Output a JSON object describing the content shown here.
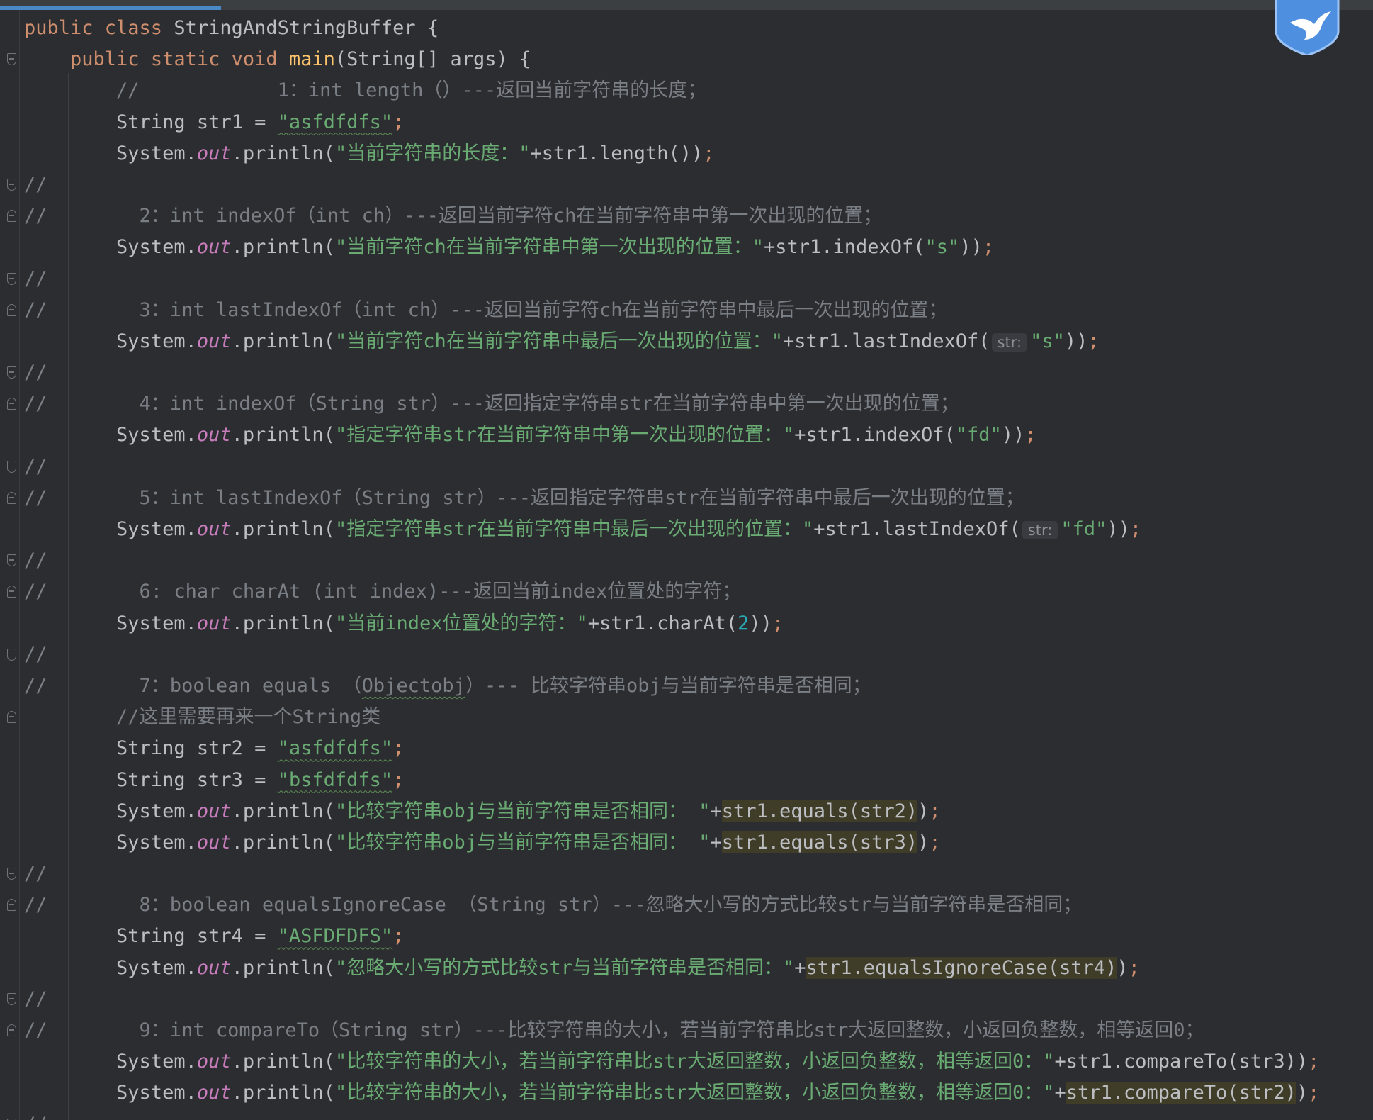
{
  "colors": {
    "background": "#2b2d30",
    "keyword": "#cf8e6d",
    "string": "#6aab73",
    "comment": "#7a7e85",
    "method_decl": "#ffc66d",
    "number": "#2aacb8",
    "static_field": "#c77dbb",
    "accent": "#4a88c7",
    "highlight": "#3f3d27"
  },
  "icons": {
    "logo": "shield-bird-icon",
    "fold": "fold-marker-icon"
  },
  "lines": [
    {
      "segs": [
        {
          "t": "public class ",
          "c": "kw"
        },
        {
          "t": "StringAndStringBuffer {"
        }
      ]
    },
    {
      "fold": "down",
      "segs": [
        {
          "t": "    "
        },
        {
          "t": "public static void ",
          "c": "kw"
        },
        {
          "t": "main",
          "c": "fn"
        },
        {
          "t": "(String[] args) {"
        }
      ]
    },
    {
      "segs": [
        {
          "t": "        "
        },
        {
          "t": "//            1：int length（）---返回当前字符串的长度；",
          "c": "cm"
        }
      ]
    },
    {
      "segs": [
        {
          "t": "        String str1 = "
        },
        {
          "t": "\"asfdfdfs\"",
          "c": "str",
          "w": 1
        },
        {
          "t": ";",
          "c": "semi"
        }
      ]
    },
    {
      "segs": [
        {
          "t": "        System."
        },
        {
          "t": "out",
          "c": "field"
        },
        {
          "t": ".println("
        },
        {
          "t": "\"当前字符串的长度：\"",
          "c": "str"
        },
        {
          "t": "+str1.length())"
        },
        {
          "t": ";",
          "c": "semi"
        }
      ]
    },
    {
      "fold": "down",
      "segs": [
        {
          "t": "//",
          "c": "cm"
        }
      ]
    },
    {
      "fold": "up",
      "segs": [
        {
          "t": "//        2：int indexOf（int ch）---返回当前字符ch在当前字符串中第一次出现的位置；",
          "c": "cm"
        }
      ]
    },
    {
      "segs": [
        {
          "t": "        System."
        },
        {
          "t": "out",
          "c": "field"
        },
        {
          "t": ".println("
        },
        {
          "t": "\"当前字符ch在当前字符串中第一次出现的位置：\"",
          "c": "str"
        },
        {
          "t": "+str1.indexOf("
        },
        {
          "t": "\"s\"",
          "c": "str"
        },
        {
          "t": "))"
        },
        {
          "t": ";",
          "c": "semi"
        }
      ]
    },
    {
      "fold": "down",
      "segs": [
        {
          "t": "//",
          "c": "cm"
        }
      ]
    },
    {
      "fold": "up",
      "segs": [
        {
          "t": "//        3：int lastIndexOf（int ch）---返回当前字符ch在当前字符串中最后一次出现的位置；",
          "c": "cm"
        }
      ]
    },
    {
      "segs": [
        {
          "t": "        System."
        },
        {
          "t": "out",
          "c": "field"
        },
        {
          "t": ".println("
        },
        {
          "t": "\"当前字符ch在当前字符串中最后一次出现的位置：\"",
          "c": "str"
        },
        {
          "t": "+str1.lastIndexOf("
        },
        {
          "t": "str:",
          "c": "hint"
        },
        {
          "t": "\"s\"",
          "c": "str"
        },
        {
          "t": "))"
        },
        {
          "t": ";",
          "c": "semi"
        }
      ]
    },
    {
      "fold": "down",
      "segs": [
        {
          "t": "//",
          "c": "cm"
        }
      ]
    },
    {
      "fold": "up",
      "segs": [
        {
          "t": "//        4：int indexOf（String str）---返回指定字符串str在当前字符串中第一次出现的位置；",
          "c": "cm"
        }
      ]
    },
    {
      "segs": [
        {
          "t": "        System."
        },
        {
          "t": "out",
          "c": "field"
        },
        {
          "t": ".println("
        },
        {
          "t": "\"指定字符串str在当前字符串中第一次出现的位置：\"",
          "c": "str"
        },
        {
          "t": "+str1.indexOf("
        },
        {
          "t": "\"fd\"",
          "c": "str"
        },
        {
          "t": "))"
        },
        {
          "t": ";",
          "c": "semi"
        }
      ]
    },
    {
      "fold": "down",
      "segs": [
        {
          "t": "//",
          "c": "cm"
        }
      ]
    },
    {
      "fold": "up",
      "segs": [
        {
          "t": "//        5：int lastIndexOf（String str）---返回指定字符串str在当前字符串中最后一次出现的位置；",
          "c": "cm"
        }
      ]
    },
    {
      "segs": [
        {
          "t": "        System."
        },
        {
          "t": "out",
          "c": "field"
        },
        {
          "t": ".println("
        },
        {
          "t": "\"指定字符串str在当前字符串中最后一次出现的位置：\"",
          "c": "str"
        },
        {
          "t": "+str1.lastIndexOf("
        },
        {
          "t": "str:",
          "c": "hint"
        },
        {
          "t": "\"fd\"",
          "c": "str"
        },
        {
          "t": "))"
        },
        {
          "t": ";",
          "c": "semi"
        }
      ]
    },
    {
      "fold": "down",
      "segs": [
        {
          "t": "//",
          "c": "cm"
        }
      ]
    },
    {
      "fold": "up",
      "segs": [
        {
          "t": "//        6: char charAt (int index)---返回当前index位置处的字符；",
          "c": "cm"
        }
      ]
    },
    {
      "segs": [
        {
          "t": "        System."
        },
        {
          "t": "out",
          "c": "field"
        },
        {
          "t": ".println("
        },
        {
          "t": "\"当前index位置处的字符：\"",
          "c": "str"
        },
        {
          "t": "+str1.charAt("
        },
        {
          "t": "2",
          "c": "num"
        },
        {
          "t": "))"
        },
        {
          "t": ";",
          "c": "semi"
        }
      ]
    },
    {
      "fold": "down",
      "segs": [
        {
          "t": "//",
          "c": "cm"
        }
      ]
    },
    {
      "segs": [
        {
          "t": "//        7：boolean equals （",
          "c": "cm"
        },
        {
          "t": "Objectobj",
          "c": "cm",
          "w": 1
        },
        {
          "t": "）--- 比较字符串obj与当前字符串是否相同；",
          "c": "cm"
        }
      ]
    },
    {
      "fold": "up",
      "segs": [
        {
          "t": "        "
        },
        {
          "t": "//这里需要再来一个String类",
          "c": "cm"
        }
      ]
    },
    {
      "segs": [
        {
          "t": "        String str2 = "
        },
        {
          "t": "\"asfdfdfs\"",
          "c": "str",
          "w": 1
        },
        {
          "t": ";",
          "c": "semi"
        }
      ]
    },
    {
      "segs": [
        {
          "t": "        String str3 = "
        },
        {
          "t": "\"bsfdfdfs\"",
          "c": "str",
          "w": 1
        },
        {
          "t": ";",
          "c": "semi"
        }
      ]
    },
    {
      "segs": [
        {
          "t": "        System."
        },
        {
          "t": "out",
          "c": "field"
        },
        {
          "t": ".println("
        },
        {
          "t": "\"比较字符串obj与当前字符串是否相同： \"",
          "c": "str"
        },
        {
          "t": "+"
        },
        {
          "t": "str1.equals(str2)",
          "c": "hl"
        },
        {
          "t": ")"
        },
        {
          "t": ";",
          "c": "semi"
        }
      ]
    },
    {
      "segs": [
        {
          "t": "        System."
        },
        {
          "t": "out",
          "c": "field"
        },
        {
          "t": ".println("
        },
        {
          "t": "\"比较字符串obj与当前字符串是否相同： \"",
          "c": "str"
        },
        {
          "t": "+"
        },
        {
          "t": "str1.equals(str3)",
          "c": "hl"
        },
        {
          "t": ")"
        },
        {
          "t": ";",
          "c": "semi"
        }
      ]
    },
    {
      "fold": "down",
      "segs": [
        {
          "t": "//",
          "c": "cm"
        }
      ]
    },
    {
      "fold": "up",
      "segs": [
        {
          "t": "//        8：boolean equalsIgnoreCase （String str）---忽略大小写的方式比较str与当前字符串是否相同；",
          "c": "cm"
        }
      ]
    },
    {
      "segs": [
        {
          "t": "        String str4 = "
        },
        {
          "t": "\"ASFDFDFS\"",
          "c": "str",
          "w": 1
        },
        {
          "t": ";",
          "c": "semi"
        }
      ]
    },
    {
      "segs": [
        {
          "t": "        System."
        },
        {
          "t": "out",
          "c": "field"
        },
        {
          "t": ".println("
        },
        {
          "t": "\"忽略大小写的方式比较str与当前字符串是否相同：\"",
          "c": "str"
        },
        {
          "t": "+"
        },
        {
          "t": "str1.equalsIgnoreCase(str4)",
          "c": "hl"
        },
        {
          "t": ")"
        },
        {
          "t": ";",
          "c": "semi"
        }
      ]
    },
    {
      "fold": "down",
      "segs": [
        {
          "t": "//",
          "c": "cm"
        }
      ]
    },
    {
      "fold": "up",
      "segs": [
        {
          "t": "//        9：int compareTo（String str）---比较字符串的大小，若当前字符串比str大返回整数，小返回负整数，相等返回0；",
          "c": "cm"
        }
      ]
    },
    {
      "segs": [
        {
          "t": "        System."
        },
        {
          "t": "out",
          "c": "field"
        },
        {
          "t": ".println("
        },
        {
          "t": "\"比较字符串的大小，若当前字符串比str大返回整数，小返回负整数，相等返回0：\"",
          "c": "str"
        },
        {
          "t": "+str1.compareTo(str3))"
        },
        {
          "t": ";",
          "c": "semi"
        }
      ]
    },
    {
      "segs": [
        {
          "t": "        System."
        },
        {
          "t": "out",
          "c": "field"
        },
        {
          "t": ".println("
        },
        {
          "t": "\"比较字符串的大小，若当前字符串比str大返回整数，小返回负整数，相等返回0：\"",
          "c": "str"
        },
        {
          "t": "+"
        },
        {
          "t": "str1.compareTo(str2)",
          "c": "hl"
        },
        {
          "t": ")"
        },
        {
          "t": ";",
          "c": "semi"
        }
      ]
    },
    {
      "fold": "down",
      "segs": [
        {
          "t": "//",
          "c": "cm"
        }
      ]
    }
  ]
}
